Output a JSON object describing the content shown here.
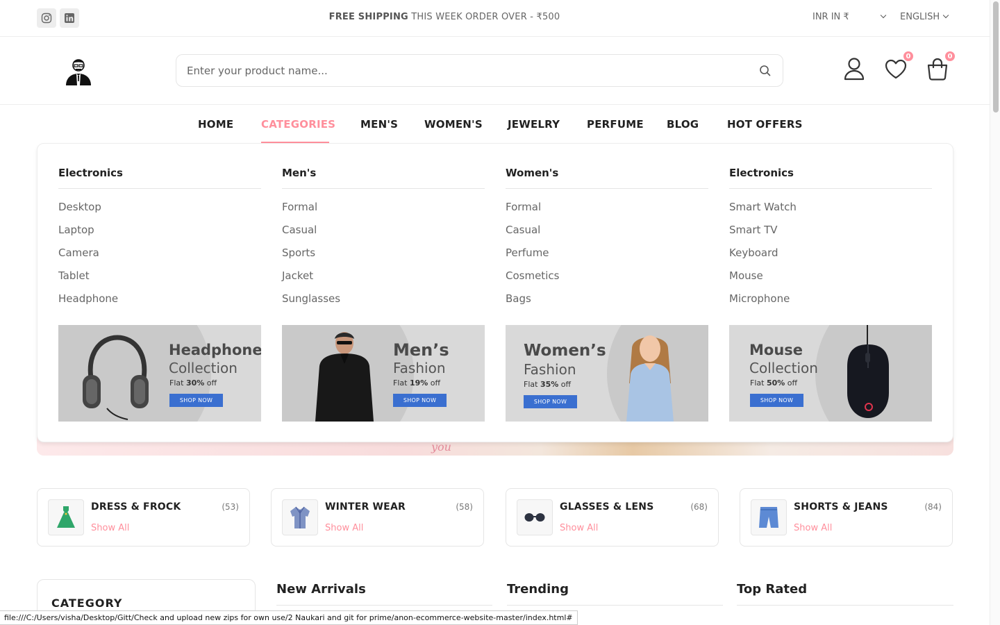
{
  "topbar": {
    "message_bold": "FREE SHIPPING",
    "message_rest": " THIS WEEK ORDER OVER - ₹500",
    "currency": "INR IN ₹",
    "language": "ENGLISH"
  },
  "search": {
    "placeholder": "Enter your product name..."
  },
  "header": {
    "wishlist_count": "0",
    "cart_count": "0"
  },
  "nav": {
    "items": [
      "HOME",
      "CATEGORIES",
      "MEN'S",
      "WOMEN'S",
      "JEWELRY",
      "PERFUME",
      "BLOG",
      "HOT OFFERS"
    ],
    "active": "CATEGORIES"
  },
  "dropdown": {
    "columns": [
      {
        "title": "Electronics",
        "items": [
          "Desktop",
          "Laptop",
          "Camera",
          "Tablet",
          "Headphone"
        ]
      },
      {
        "title": "Men's",
        "items": [
          "Formal",
          "Casual",
          "Sports",
          "Jacket",
          "Sunglasses"
        ]
      },
      {
        "title": "Women's",
        "items": [
          "Formal",
          "Casual",
          "Perfume",
          "Cosmetics",
          "Bags"
        ]
      },
      {
        "title": "Electronics",
        "items": [
          "Smart Watch",
          "Smart TV",
          "Keyboard",
          "Mouse",
          "Microphone"
        ]
      }
    ],
    "banners": [
      {
        "line1": "Headphone",
        "line2": "Collection",
        "flat": "Flat ",
        "discount": "30%",
        "off": " off",
        "cta": "SHOP NOW"
      },
      {
        "line1": "Men’s",
        "line2": "Fashion",
        "flat": "Flat ",
        "discount": "19%",
        "off": " off",
        "cta": "SHOP NOW"
      },
      {
        "line1": "Women’s",
        "line2": "Fashion",
        "flat": "Flat ",
        "discount": "35%",
        "off": " off",
        "cta": "SHOP NOW"
      },
      {
        "line1": "Mouse",
        "line2": "Collection",
        "flat": "Flat ",
        "discount": "50%",
        "off": " off",
        "cta": "SHOP NOW"
      }
    ]
  },
  "hero": {
    "peek_text": "you"
  },
  "categories": [
    {
      "title": "DRESS & FROCK",
      "count": "(53)",
      "link": "Show All",
      "icon": "dress-icon"
    },
    {
      "title": "WINTER WEAR",
      "count": "(58)",
      "link": "Show All",
      "icon": "coat-icon"
    },
    {
      "title": "GLASSES & LENS",
      "count": "(68)",
      "link": "Show All",
      "icon": "glasses-icon"
    },
    {
      "title": "SHORTS & JEANS",
      "count": "(84)",
      "link": "Show All",
      "icon": "shorts-icon"
    }
  ],
  "sidebar": {
    "title": "CATEGORY"
  },
  "sections": [
    "New Arrivals",
    "Trending",
    "Top Rated"
  ],
  "statusbar": {
    "url": "file:///C:/Users/visha/Desktop/Gitt/Check and upload new zips for own use/2 Naukari and git for prime/anon-ecommerce-website-master/index.html#"
  },
  "colors": {
    "accent": "#ff8f9c",
    "shop_button": "#3a6fd0",
    "text_dark": "#212121"
  }
}
